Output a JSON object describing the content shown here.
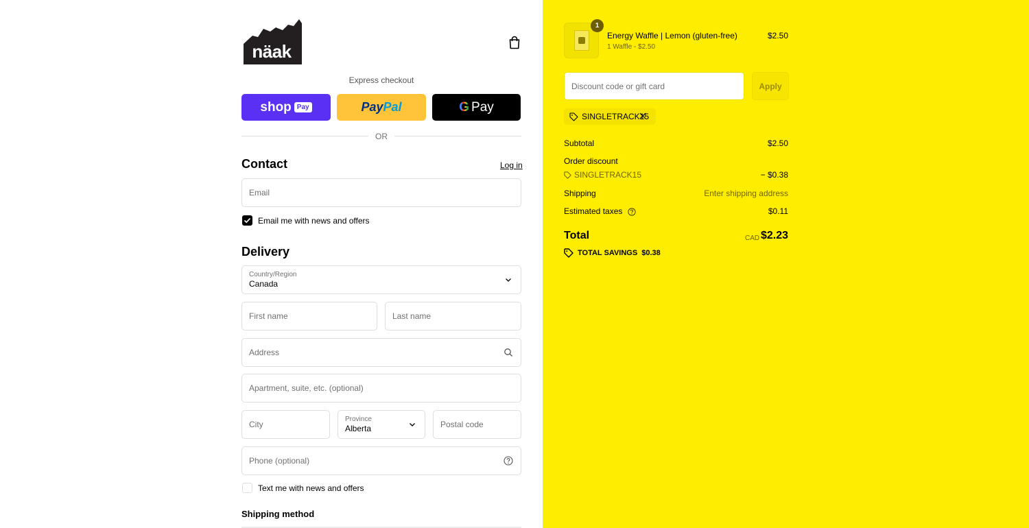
{
  "header": {
    "logo_text": "näak"
  },
  "express": {
    "title": "Express checkout",
    "shop_pay_label": "shop",
    "shop_pay_badge": "Pay",
    "paypal_part1": "Pay",
    "paypal_part2": "Pal",
    "gpay_g": "G",
    "gpay_label": "Pay",
    "or": "OR"
  },
  "contact": {
    "title": "Contact",
    "login": "Log in",
    "email_placeholder": "Email",
    "news_label": "Email me with news and offers",
    "news_checked": true
  },
  "delivery": {
    "title": "Delivery",
    "country_label": "Country/Region",
    "country_value": "Canada",
    "first_name": "First name",
    "last_name": "Last name",
    "address": "Address",
    "apartment": "Apartment, suite, etc. (optional)",
    "city": "City",
    "province_label": "Province",
    "province_value": "Alberta",
    "postal": "Postal code",
    "phone": "Phone (optional)",
    "text_label": "Text me with news and offers",
    "text_checked": false
  },
  "shipping_method": {
    "title": "Shipping method"
  },
  "summary": {
    "product": {
      "quantity": "1",
      "name": "Energy Waffle | Lemon (gluten-free)",
      "variant": "1 Waffle - $2.50",
      "price": "$2.50"
    },
    "discount_placeholder": "Discount code or gift card",
    "apply": "Apply",
    "applied_code": "SINGLETRACK15",
    "subtotal_label": "Subtotal",
    "subtotal_value": "$2.50",
    "order_discount_label": "Order discount",
    "order_discount_code": "SINGLETRACK15",
    "order_discount_value": "− $0.38",
    "shipping_label": "Shipping",
    "shipping_value": "Enter shipping address",
    "taxes_label": "Estimated taxes",
    "taxes_value": "$0.11",
    "total_label": "Total",
    "currency": "CAD",
    "total_value": "$2.23",
    "savings_label": "TOTAL SAVINGS",
    "savings_value": "$0.38"
  },
  "colors": {
    "summary_bg": "#ffed00",
    "shop_pay": "#5a31f4",
    "paypal": "#ffc439"
  }
}
